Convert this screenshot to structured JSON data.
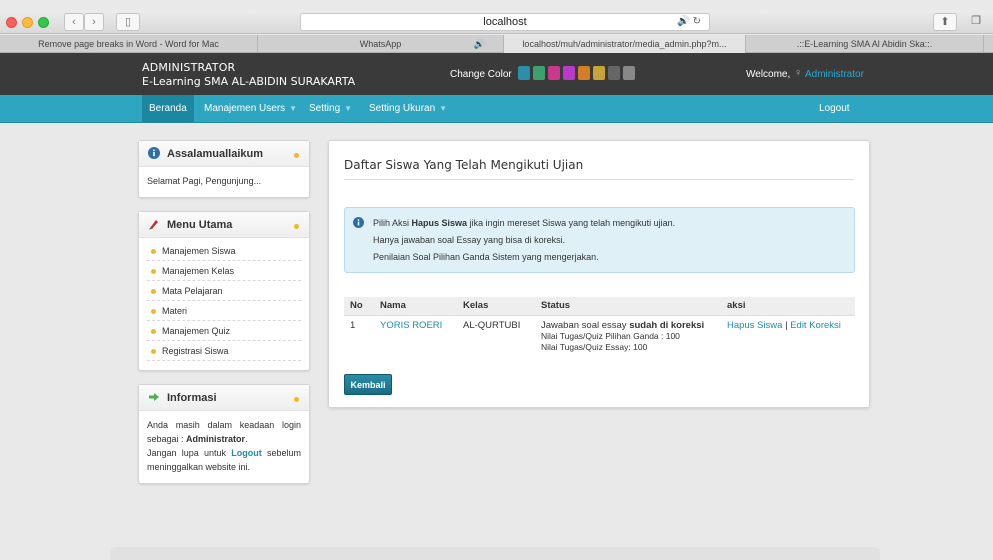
{
  "browser": {
    "url": "localhost",
    "tabs": [
      {
        "label": "Remove page breaks in Word - Word for Mac"
      },
      {
        "label": "WhatsApp"
      },
      {
        "label": "localhost/muh/administrator/media_admin.php?m..."
      },
      {
        "label": ".::E-Learning SMA Al Abidin Ska::."
      }
    ]
  },
  "header": {
    "line1": "ADMINISTRATOR",
    "line2": "E-Learning SMA AL-ABIDIN SURAKARTA",
    "change_color_label": "Change Color",
    "swatches": [
      "#2c8fa9",
      "#3aa26a",
      "#c8388c",
      "#b83ac9",
      "#d37f25",
      "#c9a23a",
      "#666666",
      "#888888"
    ],
    "welcome": "Welcome,",
    "user": "Administrator"
  },
  "nav": {
    "home": "Beranda",
    "users": "Manajemen Users",
    "setting": "Setting",
    "ukuran": "Setting Ukuran",
    "logout": "Logout"
  },
  "sidebar": {
    "greet": {
      "title": "Assalamuallaikum",
      "text": "Selamat Pagi, Pengunjung..."
    },
    "menu": {
      "title": "Menu Utama",
      "items": [
        "Manajemen Siswa",
        "Manajemen Kelas",
        "Mata Pelajaran",
        "Materi",
        "Manajemen Quiz",
        "Registrasi Siswa"
      ]
    },
    "info": {
      "title": "Informasi",
      "text1": "Anda masih dalam keadaan login sebagai :",
      "user": "Administrator",
      "text2": "Jangan lupa untuk",
      "logout": "Logout",
      "text3": "sebelum meninggalkan website ini."
    }
  },
  "main": {
    "title": "Daftar Siswa Yang Telah Mengikuti Ujian",
    "alert": {
      "l1_pre": "Pilih Aksi",
      "l1_bold": "Hapus Siswa",
      "l1_post": "jika ingin mereset Siswa yang telah mengikuti ujian.",
      "l2": "Hanya jawaban soal Essay yang bisa di koreksi.",
      "l3": "Penilaian Soal Pilihan Ganda Sistem yang mengerjakan."
    },
    "table": {
      "headers": {
        "no": "No",
        "nama": "Nama",
        "kelas": "Kelas",
        "status": "Status",
        "aksi": "aksi"
      },
      "rows": [
        {
          "no": "1",
          "nama": "YORIS ROERI",
          "kelas": "AL-QURTUBI",
          "status_pre": "Jawaban soal essay",
          "status_bold": "sudah di koreksi",
          "nilai_pg": "Nilai Tugas/Quiz Pilihan Ganda : 100",
          "nilai_essay": "Nilai Tugas/Quiz Essay: 100",
          "hapus": "Hapus Siswa",
          "sep": "|",
          "edit": "Edit Koreksi"
        }
      ]
    },
    "back_button": "Kembali"
  }
}
